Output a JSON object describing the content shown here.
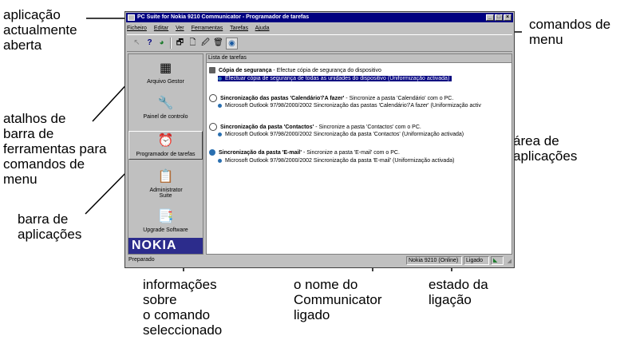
{
  "callouts": {
    "app_open": "aplicação\nactualmente\naberta",
    "menu_commands": "comandos de\nmenu",
    "toolbar_shortcuts": "atalhos de\nbarra de\nferramentas para\ncomandos de\nmenu",
    "app_area": "área de\naplicações",
    "app_bar": "barra de\naplicações",
    "status_info": "informações\nsobre\no comando\nseleccionado",
    "communicator_name": "o nome do\nCommunicator\nligado",
    "connection_status": "estado da\nligação"
  },
  "window": {
    "title": "PC Suite for Nokia 9210 Communicator - Programador de tarefas",
    "minimize": "_",
    "maximize": "□",
    "close": "×"
  },
  "menu": [
    "Ficheiro",
    "Editar",
    "Ver",
    "Ferramentas",
    "Tarefas",
    "Ajuda"
  ],
  "toolbar_icons": [
    "back-icon",
    "help-icon",
    "sync-icon",
    "window-icon",
    "new-task-icon",
    "edit-task-icon",
    "delete-task-icon",
    "run-icon"
  ],
  "appbar": {
    "items": [
      {
        "label": "Arquivo Gestor",
        "icon": "archive-manager-icon"
      },
      {
        "label": "Painel de controlo",
        "icon": "control-panel-icon"
      },
      {
        "label": "Programador de tarefas",
        "icon": "task-scheduler-icon"
      },
      {
        "label": "Administrator Suite",
        "icon": "administrator-suite-icon"
      },
      {
        "label": "Upgrade Software",
        "icon": "upgrade-software-icon"
      }
    ],
    "brand": "NOKIA"
  },
  "list": {
    "header": "Lista de tarefas",
    "tasks": [
      {
        "title": "Cópia de segurança",
        "desc": " - Efectue cópia de segurança do dispositivo",
        "sub": "Efectuar cópia de segurança de todas as unidades do dispositivo (Uniformização activada)",
        "selected": true
      },
      {
        "title": "Sincronização das pastas 'Calendário'/'A fazer'",
        "desc": " - Sincronize a pasta 'Calendário' com o PC.",
        "sub": "Microsoft Outlook 97/98/2000/2002 Sincronização das pastas 'Calendário'/'A fazer' (Uniformização activ",
        "selected": false
      },
      {
        "title": "Sincronização da pasta 'Contactos'",
        "desc": " - Sincronize a pasta 'Contactos' com o PC.",
        "sub": "Microsoft Outlook 97/98/2000/2002 Sincronização da pasta 'Contactos' (Uniformização activada)",
        "selected": false
      },
      {
        "title": "Sincronização da pasta 'E-mail'",
        "desc": " - Sincronize a pasta 'E-mail' com o PC.",
        "sub": "Microsoft Outlook 97/98/2000/2002 Sincronização da pasta 'E-mail' (Uniformização activada)",
        "selected": false
      }
    ]
  },
  "status": {
    "text": "Preparado",
    "device": "Nokia 9210 (Online)",
    "connection": "Ligado"
  }
}
